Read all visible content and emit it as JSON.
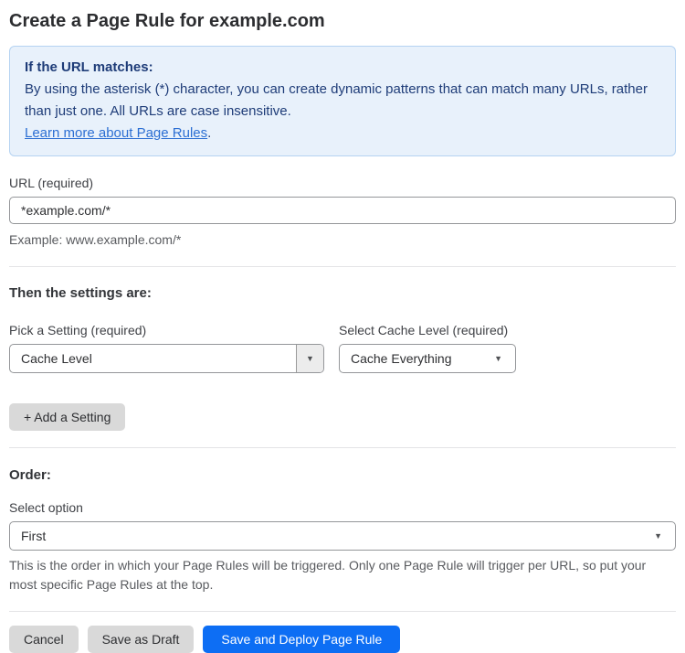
{
  "page": {
    "title": "Create a Page Rule for example.com"
  },
  "info_box": {
    "heading": "If the URL matches:",
    "body": "By using the asterisk (*) character, you can create dynamic patterns that can match many URLs, rather than just one. All URLs are case insensitive.",
    "link_label": "Learn more about Page Rules",
    "link_suffix": "."
  },
  "url_field": {
    "label": "URL (required)",
    "value": "*example.com/*",
    "helper": "Example: www.example.com/*"
  },
  "settings_section": {
    "heading": "Then the settings are:",
    "setting_label": "Pick a Setting (required)",
    "setting_value": "Cache Level",
    "cache_label": "Select Cache Level (required)",
    "cache_value": "Cache Everything",
    "add_button_label": "+ Add a Setting",
    "dropdown_arrow": "▼"
  },
  "order_section": {
    "heading": "Order:",
    "label": "Select option",
    "value": "First",
    "helper": "This is the order in which your Page Rules will be triggered. Only one Page Rule will trigger per URL, so put your most specific Page Rules at the top.",
    "dropdown_arrow": "▼"
  },
  "actions": {
    "cancel_label": "Cancel",
    "save_draft_label": "Save as Draft",
    "save_deploy_label": "Save and Deploy Page Rule"
  },
  "colors": {
    "accent_blue": "#0d6ef4",
    "button_gray": "#d9d9d9",
    "info_bg": "#e8f1fb",
    "info_border": "#b5d3f2",
    "info_text": "#1e3c78",
    "link_blue": "#2c6fd3"
  }
}
